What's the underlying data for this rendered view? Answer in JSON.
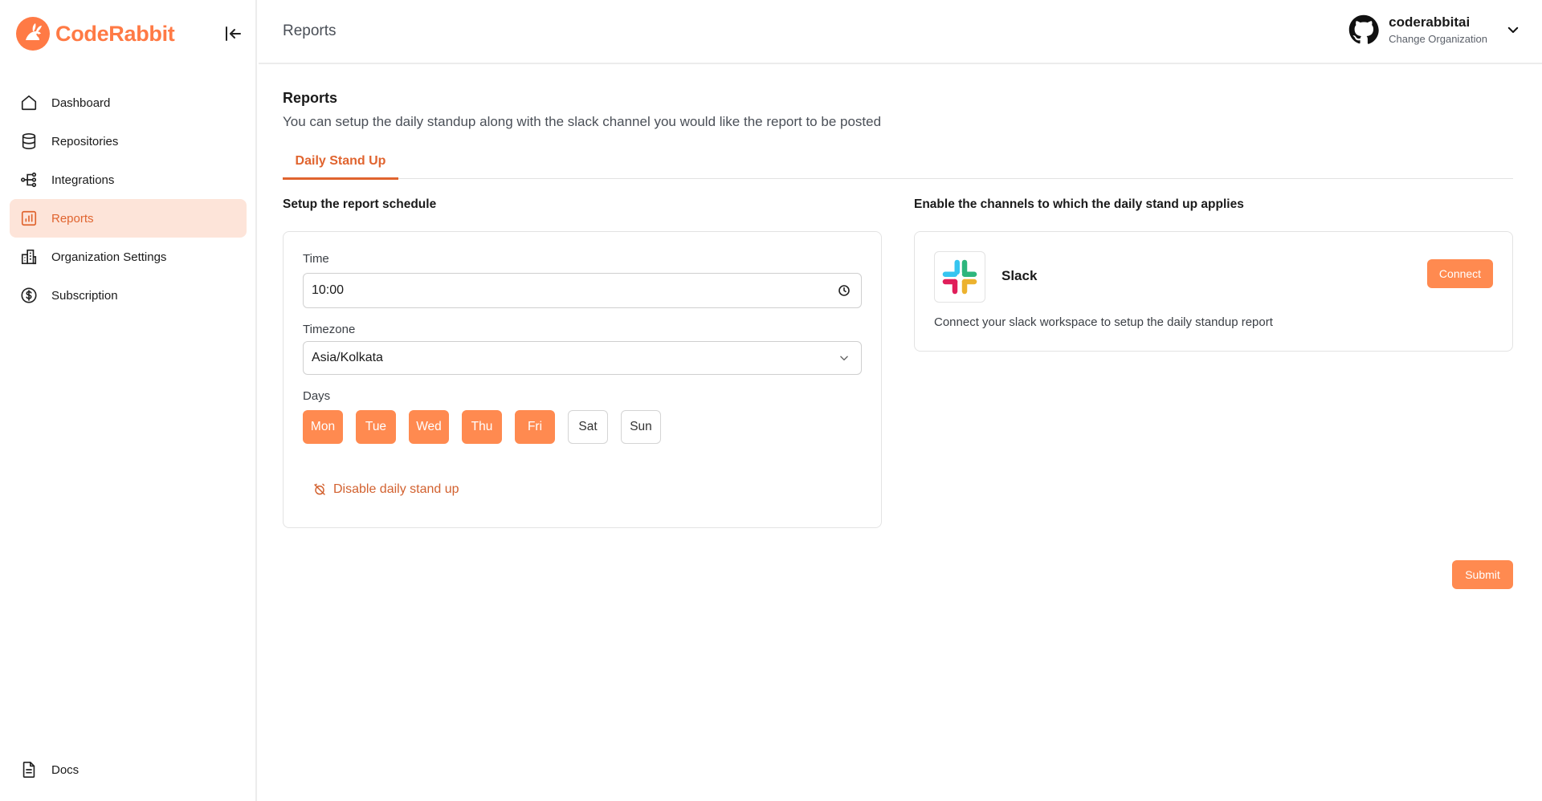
{
  "brand": {
    "name": "CodeRabbit",
    "accent": "#ff7a45"
  },
  "sidebar": {
    "items": [
      {
        "label": "Dashboard",
        "icon": "home-icon"
      },
      {
        "label": "Repositories",
        "icon": "database-icon"
      },
      {
        "label": "Integrations",
        "icon": "integrations-icon"
      },
      {
        "label": "Reports",
        "icon": "chart-icon",
        "active": true
      },
      {
        "label": "Organization Settings",
        "icon": "building-icon"
      },
      {
        "label": "Subscription",
        "icon": "dollar-circle-icon"
      }
    ],
    "docs_label": "Docs"
  },
  "header": {
    "title": "Reports",
    "org_name": "coderabbitai",
    "org_sub": "Change Organization"
  },
  "main": {
    "title": "Reports",
    "description": "You can setup the daily standup along with the slack channel you would like the report to be posted",
    "tabs": [
      {
        "label": "Daily Stand Up",
        "active": true
      }
    ],
    "schedule": {
      "title": "Setup the report schedule",
      "time_label": "Time",
      "time_value": "10:00",
      "timezone_label": "Timezone",
      "timezone_value": "Asia/Kolkata",
      "days_label": "Days",
      "days": [
        {
          "label": "Mon",
          "selected": true
        },
        {
          "label": "Tue",
          "selected": true
        },
        {
          "label": "Wed",
          "selected": true
        },
        {
          "label": "Thu",
          "selected": true
        },
        {
          "label": "Fri",
          "selected": true
        },
        {
          "label": "Sat",
          "selected": false
        },
        {
          "label": "Sun",
          "selected": false
        }
      ],
      "disable_label": "Disable daily stand up"
    },
    "channels": {
      "title": "Enable the channels to which the daily stand up applies",
      "slack_name": "Slack",
      "slack_desc": "Connect your slack workspace to setup the daily standup report",
      "connect_label": "Connect"
    },
    "submit_label": "Submit"
  }
}
